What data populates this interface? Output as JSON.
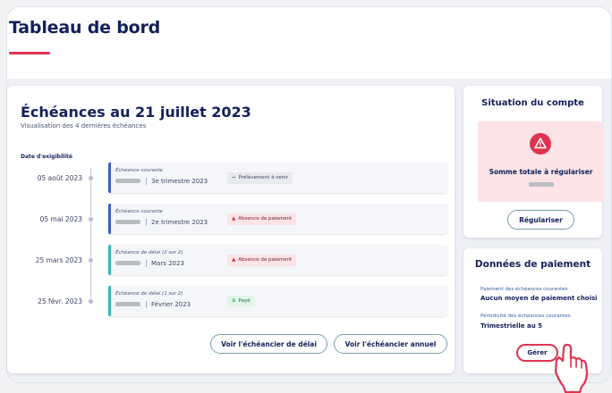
{
  "page": {
    "title": "Tableau de bord"
  },
  "echeances": {
    "title": "Échéances au 21 juillet 2023",
    "subtitle": "Visualisation des 4 dernières échéances",
    "column_label": "Date d'exigibilité",
    "rows": [
      {
        "date": "05 août 2023",
        "type": "Échéance courante",
        "period": "3e trimestre 2023",
        "status": "Prélèvement à venir",
        "status_icon": "dash-icon",
        "status_kind": "pending",
        "bar_color": "#3d5fc4"
      },
      {
        "date": "05 mai 2023",
        "type": "Échéance courante",
        "period": "2e trimestre 2023",
        "status": "Absence de paiement",
        "status_icon": "warning-icon",
        "status_kind": "error",
        "bar_color": "#3d5fc4"
      },
      {
        "date": "25 mars 2023",
        "type": "Échéance de délai (2 sur 2)",
        "period": "Mars 2023",
        "status": "Absence de paiement",
        "status_icon": "warning-icon",
        "status_kind": "error",
        "bar_color": "#35b8b5"
      },
      {
        "date": "25 févr. 2023",
        "type": "Échéance de délai (1 sur 2)",
        "period": "Février 2023",
        "status": "Payé",
        "status_icon": "check-icon",
        "status_kind": "success",
        "bar_color": "#35b8b5"
      }
    ],
    "buttons": {
      "delai": "Voir l'échéancier de délai",
      "annuel": "Voir l'échéancier annuel"
    }
  },
  "situation": {
    "title": "Situation du compte",
    "alert_label": "Somme totale à régulariser",
    "alert_icon": "warning-icon",
    "button": "Régulariser"
  },
  "paiement": {
    "title": "Données de paiement",
    "label_moyen": "Paiement des échéances courantes",
    "value_moyen": "Aucun moyen de paiement choisi",
    "label_periodicite": "Périodicité des échéances courantes",
    "value_periodicite": "Trimestrielle au 5",
    "button": "Gérer",
    "pointer_icon": "hand-pointer-icon"
  },
  "colors": {
    "navy": "#12205a",
    "accent_red": "#e0334f",
    "bar_courante": "#3d5fc4",
    "bar_delai": "#35b8b5",
    "alert_bg": "#fbe3e6",
    "page_bg": "#eef0f6"
  }
}
